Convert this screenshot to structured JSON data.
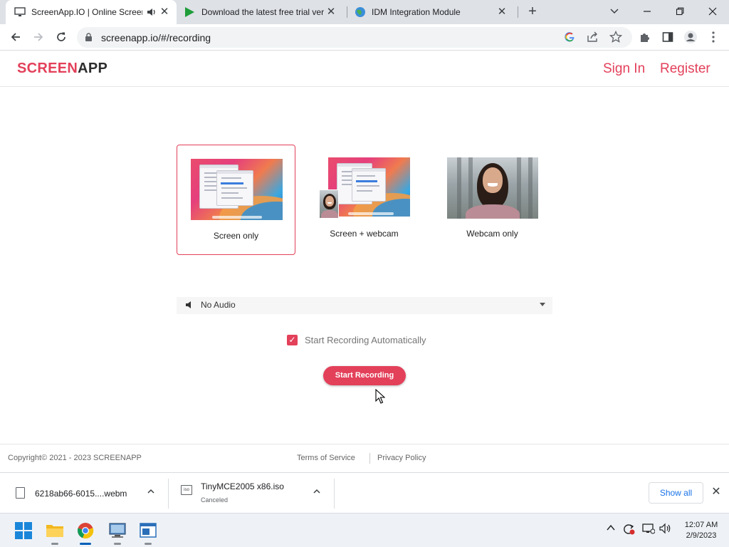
{
  "browser": {
    "tabs": [
      {
        "title": "ScreenApp.IO | Online Screen Recorder",
        "active": true
      },
      {
        "title": "Download the latest free trial version",
        "active": false
      },
      {
        "title": "IDM Integration Module",
        "active": false
      }
    ],
    "new_tab_label": "+",
    "url": "screenapp.io/#/recording"
  },
  "site": {
    "logo_part1": "SCREEN",
    "logo_part2": "APP",
    "brand_color": "#e3405a",
    "nav": {
      "sign_in": "Sign In",
      "register": "Register"
    }
  },
  "recording": {
    "modes": [
      {
        "label": "Screen only",
        "selected": true
      },
      {
        "label": "Screen + webcam",
        "selected": false
      },
      {
        "label": "Webcam only",
        "selected": false
      }
    ],
    "audio_selected": "No Audio",
    "auto_start_label": "Start Recording Automatically",
    "auto_start_checked": true,
    "start_button": "Start Recording"
  },
  "footer": {
    "copyright": "Copyright©  2021 - 2023 SCREENAPP",
    "terms": "Terms of Service",
    "privacy": "Privacy Policy"
  },
  "downloads": {
    "items": [
      {
        "filename": "6218ab66-6015....webm",
        "status": ""
      },
      {
        "filename": "TinyMCE2005 x86.iso",
        "status": "Canceled"
      }
    ],
    "show_all": "Show all"
  },
  "taskbar": {
    "time": "12:07 AM",
    "date": "2/9/2023"
  }
}
